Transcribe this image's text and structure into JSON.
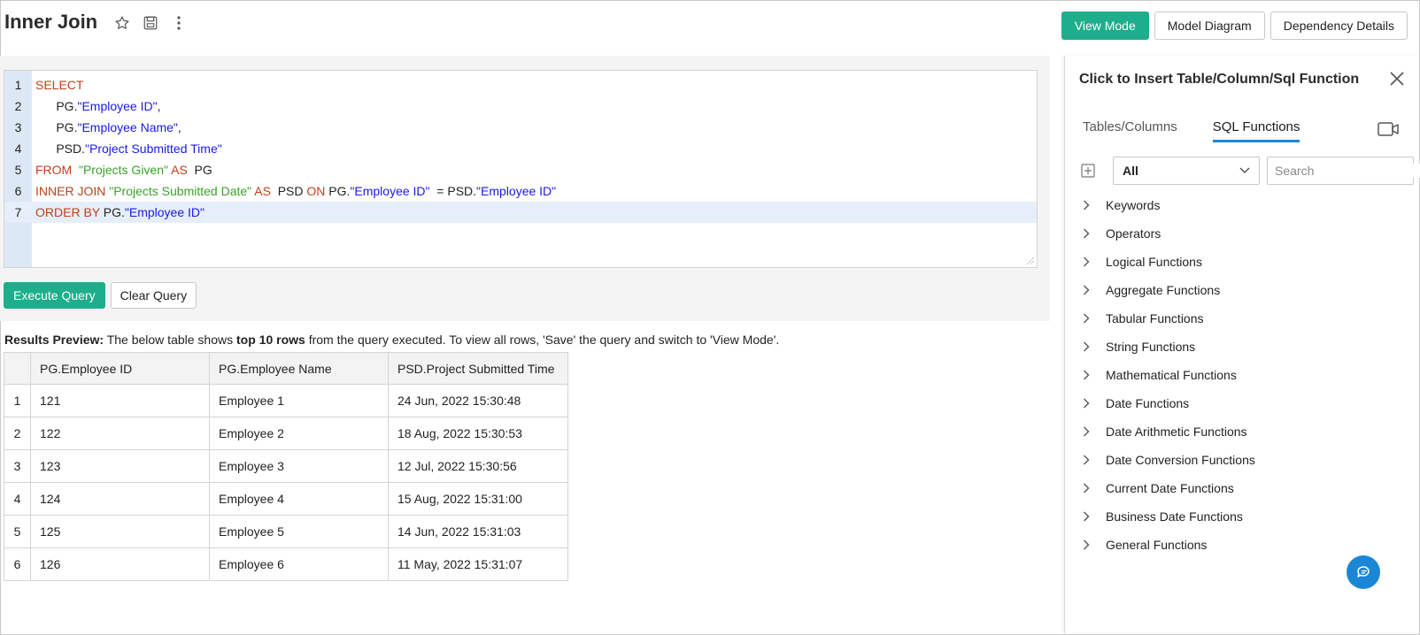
{
  "header": {
    "title": "Inner Join",
    "buttons": {
      "view_mode": "View Mode",
      "model_diagram": "Model Diagram",
      "dependency_details": "Dependency Details"
    }
  },
  "editor": {
    "line_numbers": [
      "1",
      "2",
      "3",
      "4",
      "5",
      "6",
      "7"
    ],
    "lines": {
      "l1": {
        "kw1": "SELECT"
      },
      "l2": {
        "indent": "      ",
        "prefix": "PG.",
        "id": "\"Employee ID\"",
        "suffix": ","
      },
      "l3": {
        "indent": "      ",
        "prefix": "PG.",
        "id": "\"Employee Name\"",
        "suffix": ","
      },
      "l4": {
        "indent": "      ",
        "prefix": "PSD.",
        "id": "\"Project Submitted Time\""
      },
      "l5": {
        "kw1": "FROM",
        "sp1": "  ",
        "str": "\"Projects Given\"",
        "kw2": " AS",
        "rest": "  PG"
      },
      "l6": {
        "kw1": "INNER JOIN",
        "str": " \"Projects Submitted Date\"",
        "kw2": " AS",
        "pl1": "  PSD ",
        "kw3": "ON",
        "pl2": " PG.",
        "id1": "\"Employee ID\"",
        "pl3": "  = PSD.",
        "id2": "\"Employee ID\""
      },
      "l7": {
        "kw1": "ORDER BY",
        "pl1": " PG.",
        "id1": "\"Employee ID\""
      }
    },
    "execute_label": "Execute Query",
    "clear_label": "Clear Query"
  },
  "results": {
    "label": "Results Preview:",
    "text1": " The below table shows ",
    "bold": "top 10 rows",
    "text2": " from the query executed. To view all rows, 'Save' the query and switch to 'View Mode'.",
    "columns": [
      "PG.Employee ID",
      "PG.Employee Name",
      "PSD.Project Submitted Time"
    ],
    "rows": [
      [
        "1",
        "121",
        "Employee 1",
        "24 Jun, 2022 15:30:48"
      ],
      [
        "2",
        "122",
        "Employee 2",
        "18 Aug, 2022 15:30:53"
      ],
      [
        "3",
        "123",
        "Employee 3",
        "12 Jul, 2022 15:30:56"
      ],
      [
        "4",
        "124",
        "Employee 4",
        "15 Aug, 2022 15:31:00"
      ],
      [
        "5",
        "125",
        "Employee 5",
        "14 Jun, 2022 15:31:03"
      ],
      [
        "6",
        "126",
        "Employee 6",
        "11 May, 2022 15:31:07"
      ]
    ]
  },
  "panel": {
    "title": "Click to Insert Table/Column/Sql Function",
    "tabs": [
      "Tables/Columns",
      "SQL Functions"
    ],
    "active_tab": "SQL Functions",
    "filter_value": "All",
    "search_placeholder": "Search",
    "functions": [
      "Keywords",
      "Operators",
      "Logical Functions",
      "Aggregate Functions",
      "Tabular Functions",
      "String Functions",
      "Mathematical Functions",
      "Date Functions",
      "Date Arithmetic Functions",
      "Date Conversion Functions",
      "Current Date Functions",
      "Business Date Functions",
      "General Functions"
    ]
  },
  "colors": {
    "accent": "#1fae8c",
    "tab_underline": "#1b86d6",
    "keyword": "#c0401b",
    "string": "#3aa12a",
    "identifier": "#1a1ae6"
  },
  "icons": [
    "star-icon",
    "save-icon",
    "more-vertical-icon",
    "close-icon",
    "video-icon",
    "add-icon",
    "chevron-down-icon",
    "search-icon",
    "chevron-right-icon",
    "chat-icon",
    "resize-handle-icon"
  ]
}
